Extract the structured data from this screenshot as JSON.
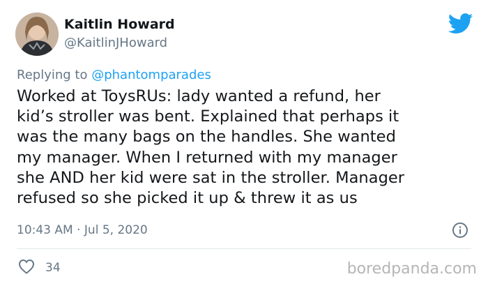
{
  "tweet": {
    "author": {
      "display_name": "Kaitlin Howard",
      "handle": "@KaitlinJHoward",
      "avatar_icon": "avatar-photo"
    },
    "brand_icon": "twitter-bird-icon",
    "replying": {
      "prefix": "Replying to ",
      "mention": "@phantomparades"
    },
    "text": "Worked at ToysRUs: lady wanted a refund, her\nkid’s stroller was bent. Explained that perhaps it\nwas the many bags on the handles. She wanted\nmy manager. When I returned with my manager\nshe AND her kid were sat in the stroller. Manager\nrefused so she picked it up & threw it as us",
    "timestamp": "10:43 AM · Jul 5, 2020",
    "info_icon": "info-icon",
    "like_icon": "heart-icon",
    "like_count": "34"
  },
  "watermark": "boredpanda.com",
  "colors": {
    "text": "#14171a",
    "secondary": "#657786",
    "accent": "#1da1f2",
    "divider": "#e1e8ed"
  }
}
